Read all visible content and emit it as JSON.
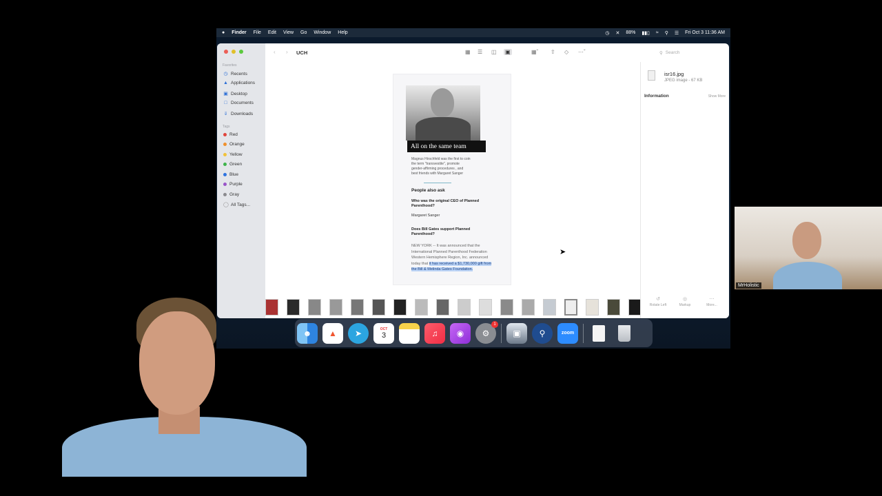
{
  "menubar": {
    "apple": "",
    "items": [
      "Finder",
      "File",
      "Edit",
      "View",
      "Go",
      "Window",
      "Help"
    ],
    "battery": "88%",
    "datetime": "Fri Oct 3  11:36 AM"
  },
  "finder": {
    "folder_title": "UCH",
    "search_placeholder": "Search",
    "sidebar": {
      "favorites_header": "Favorites",
      "favorites": [
        "Recents",
        "Applications",
        "Desktop",
        "Documents",
        "Downloads"
      ],
      "tags_header": "Tags",
      "tags": [
        {
          "label": "Red",
          "color": "#e0443c"
        },
        {
          "label": "Orange",
          "color": "#f0902c"
        },
        {
          "label": "Yellow",
          "color": "#f2c23a"
        },
        {
          "label": "Green",
          "color": "#3db44a"
        },
        {
          "label": "Blue",
          "color": "#2f74e0"
        },
        {
          "label": "Purple",
          "color": "#9a55c8"
        },
        {
          "label": "Gray",
          "color": "#8a8a8e"
        }
      ],
      "all_tags": "All Tags..."
    },
    "preview": {
      "headline": "All on the same team",
      "caption": "Magnus Hirschfeld was the first to coin the term \"transvestite\", promote gender-affirming procedures , and best friends with Margaret Sanger",
      "paa_title": "People also ask",
      "question1": "Who was the original CEO of Planned Parenthood?",
      "answer1": "Margaret Sanger",
      "question2": "Does Bill Gates support Planned Parenthood?",
      "article_text": "NEW YORK -- It was announced that the International Planned Parenthood Federation Western Hemisphere Region, Inc. announced today that ",
      "article_highlight": "it has received a $1,730,000 gift from the Bill & Melinda Gates Foundation."
    },
    "info": {
      "file_name": "isr16.jpg",
      "file_kind": "JPEG image - 67 KB",
      "information_label": "Information",
      "show_more": "Show More",
      "actions": [
        "Rotate Left",
        "Markup",
        "More..."
      ]
    }
  },
  "dock": {
    "calendar_month": "OCT",
    "calendar_day": "3",
    "settings_badge": "1",
    "zoom_label": "zoom"
  },
  "webcam": {
    "name_label": "MrHolistic"
  }
}
